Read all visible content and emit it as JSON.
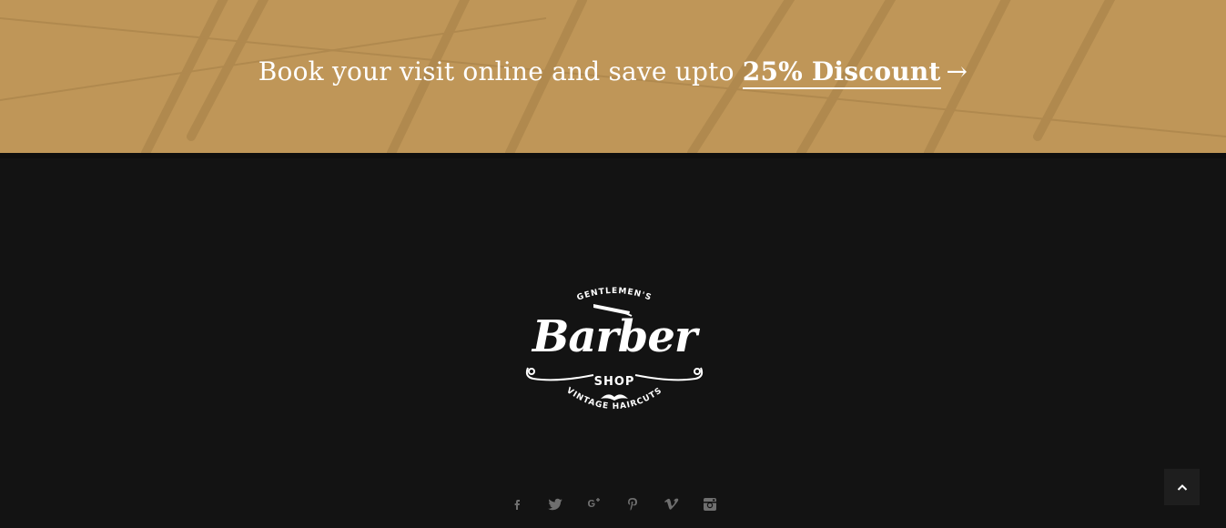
{
  "promo": {
    "text_before": "Book your visit online and save upto ",
    "link_text": "25% Discount",
    "arrow": "→",
    "background_color": "#bf9658"
  },
  "footer": {
    "background_color": "#131313",
    "logo": {
      "top_text": "GENTLEMEN'S",
      "title": "Barber",
      "subtitle": "SHOP",
      "bottom_text": "VINTAGE HAIRCUTS"
    },
    "social_icons": [
      "facebook-icon",
      "twitter-icon",
      "google-plus-icon",
      "pinterest-icon",
      "vimeo-icon",
      "instagram-icon"
    ],
    "icon_color": "#6f6f6f"
  },
  "scroll_top": {
    "icon": "chevron-up-icon"
  }
}
